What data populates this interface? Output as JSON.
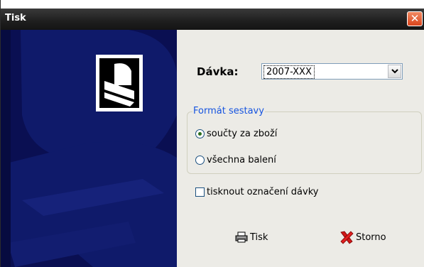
{
  "window": {
    "title": "Tisk",
    "close_symbol": "✕"
  },
  "icons": {
    "close": "close-icon",
    "print": "printer-icon",
    "cancel": "red-x-icon",
    "dropdown": "chevron-down-icon",
    "logo": "app-logo-icon"
  },
  "batch": {
    "label": "Dávka:",
    "selected_value": "2007-XXX"
  },
  "report_format": {
    "title": "Formát sestavy",
    "options": [
      {
        "label": "součty za zboží",
        "checked": true
      },
      {
        "label": "všechna balení",
        "checked": false
      }
    ]
  },
  "print_batch_mark": {
    "label": "tisknout označení dávky",
    "checked": false
  },
  "buttons": {
    "print_label": "Tisk",
    "cancel_label": "Storno"
  },
  "colors": {
    "side_panel": "#0a0f52",
    "accent_blue": "#1654e0",
    "close_red": "#d8441c"
  }
}
